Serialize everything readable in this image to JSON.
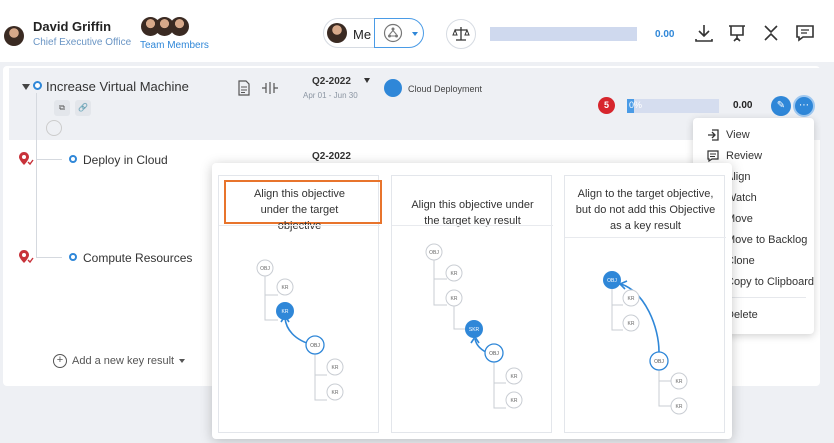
{
  "user": {
    "name": "David Griffin",
    "role": "Chief Executive Office",
    "team_label": "Team Members"
  },
  "header": {
    "me_label": "Me",
    "progress_value": "0.00"
  },
  "objective": {
    "title": "Increase Virtual Machine",
    "quarter": "Q2-2022",
    "date_range": "Apr 01 - Jun 30",
    "team": "Cloud Deployment",
    "badge_count": "5",
    "progress_label": "0%",
    "progress_fraction": 0.08,
    "progress_value": "0.00"
  },
  "key_results": [
    {
      "title": "Deploy in Cloud",
      "quarter": "Q2-2022"
    },
    {
      "title": "Compute Resources"
    }
  ],
  "add_key_result_label": "Add a new key result",
  "context_menu": {
    "items": [
      "View",
      "Review",
      "Align",
      "Watch",
      "Move",
      "Move to Backlog",
      "Clone",
      "Copy to Clipboard",
      "Delete"
    ]
  },
  "align_popup": {
    "options": [
      {
        "title": "Align this objective under the target objective",
        "selected": true
      },
      {
        "title": "Align this objective under the target key result",
        "selected": false
      },
      {
        "title": "Align to the target objective, but do not add this Objective as a key result",
        "selected": false
      }
    ],
    "node_labels": {
      "obj": "OBJ",
      "kr": "KR",
      "skr": "SKR"
    }
  },
  "colors": {
    "accent": "#2f87d8",
    "selected_border": "#e8742c",
    "badge": "#d7262d"
  },
  "icons": [
    "download-icon",
    "presentation-icon",
    "collapse-icon",
    "chat-icon",
    "balance-scale-icon",
    "hierarchy-icon"
  ]
}
